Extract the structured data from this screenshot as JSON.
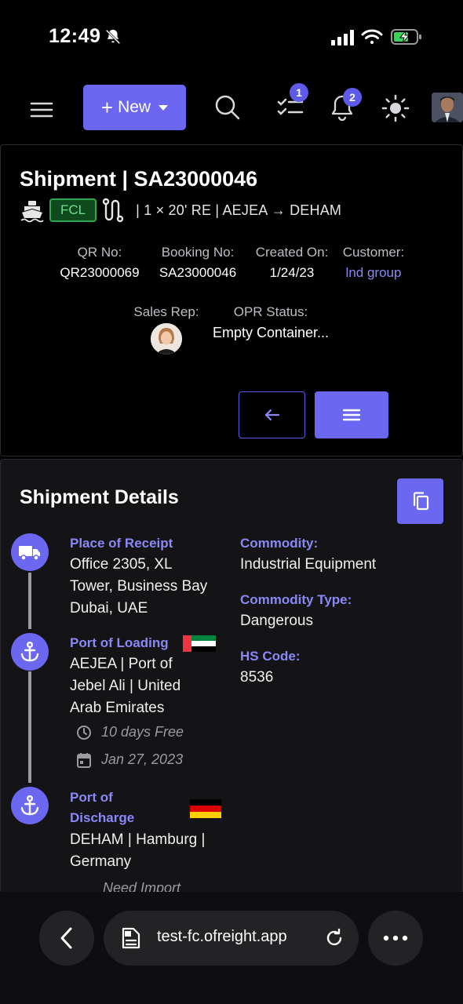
{
  "status_bar": {
    "time": "12:49"
  },
  "header": {
    "new_label": "New",
    "tasks_badge": "1",
    "notifications_badge": "2"
  },
  "shipment": {
    "title": "Shipment | SA23000046",
    "mode_badge": "FCL",
    "route": "| 1 × 20' RE | AEJEA → DEHAM",
    "qr_label": "QR No:",
    "qr_value": "QR23000069",
    "booking_label": "Booking No:",
    "booking_value": "SA23000046",
    "created_label": "Created On:",
    "created_value": "1/24/23",
    "customer_label": "Customer:",
    "customer_value": "lnd group",
    "sales_rep_label": "Sales Rep:",
    "opr_label": "OPR Status:",
    "opr_value": "Empty Container..."
  },
  "details": {
    "title": "Shipment Details",
    "receipt_label": "Place of Receipt",
    "receipt_lines": [
      "Office 2305, XL",
      "Tower, Business Bay",
      "Dubai, UAE"
    ],
    "loading_label": "Port of Loading",
    "loading_lines": [
      "AEJEA | Port of",
      "Jebel Ali | United",
      "Arab Emirates"
    ],
    "loading_free": "10 days Free",
    "loading_date": "Jan 27, 2023",
    "discharge_label_1": "Port of",
    "discharge_label_2": "Discharge",
    "discharge_lines": [
      "DEHAM | Hamburg |",
      "Germany"
    ],
    "discharge_note": "Need Import",
    "commodity_label": "Commodity:",
    "commodity_value": "Industrial Equipment",
    "commodity_type_label": "Commodity Type:",
    "commodity_type_value": "Dangerous",
    "hs_label": "HS Code:",
    "hs_value": "8536"
  },
  "browser": {
    "url": "test-fc.ofreight.app"
  },
  "colors": {
    "accent": "#6b67f0",
    "link": "#8b88f6",
    "fcl_green": "#2ea64a"
  },
  "icons": [
    "bell-off-icon",
    "signal-icon",
    "wifi-icon",
    "battery-charging-icon",
    "menu-icon",
    "search-icon",
    "tasks-icon",
    "bell-icon",
    "sun-icon",
    "ship-icon",
    "route-icon",
    "arrow-left-icon",
    "copy-icon",
    "truck-icon",
    "anchor-icon",
    "clock-icon",
    "calendar-icon",
    "uae-flag-icon",
    "germany-flag-icon",
    "chevron-left-icon",
    "document-icon",
    "reload-icon",
    "more-icon"
  ]
}
